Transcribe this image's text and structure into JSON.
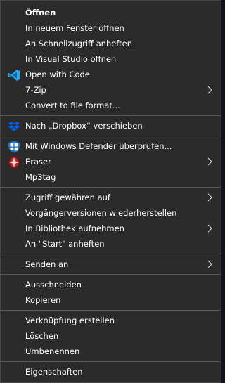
{
  "menu": {
    "items": [
      {
        "label": "Öffnen"
      },
      {
        "label": "In neuem Fenster öffnen"
      },
      {
        "label": "An Schnellzugriff anheften"
      },
      {
        "label": "In Visual Studio öffnen"
      },
      {
        "label": "Open with Code",
        "icon": "vscode-icon"
      },
      {
        "label": "7-Zip"
      },
      {
        "label": "Convert to file format..."
      },
      {
        "label": "Nach „Dropbox“ verschieben",
        "icon": "dropbox-icon"
      },
      {
        "label": "Mit Windows Defender überprüfen...",
        "icon": "windows-defender-icon"
      },
      {
        "label": "Eraser",
        "icon": "eraser-icon"
      },
      {
        "label": "Mp3tag"
      },
      {
        "label": "Zugriff gewähren auf"
      },
      {
        "label": "Vorgängerversionen wiederherstellen"
      },
      {
        "label": "In Bibliothek aufnehmen"
      },
      {
        "label": "An \"Start\" anheften"
      },
      {
        "label": "Senden an"
      },
      {
        "label": "Ausschneiden"
      },
      {
        "label": "Kopieren"
      },
      {
        "label": "Verknüpfung erstellen"
      },
      {
        "label": "Löschen"
      },
      {
        "label": "Umbenennen"
      },
      {
        "label": "Eigenschaften"
      }
    ]
  },
  "colors": {
    "background": "#2b2b2b",
    "border": "#474747",
    "separator": "#5a5a5a",
    "text": "#ffffff",
    "vscode_blue": "#23a8f2",
    "dropbox_blue": "#0061fe",
    "defender_blue": "#1a73c9",
    "eraser_red": "#c0282d"
  }
}
